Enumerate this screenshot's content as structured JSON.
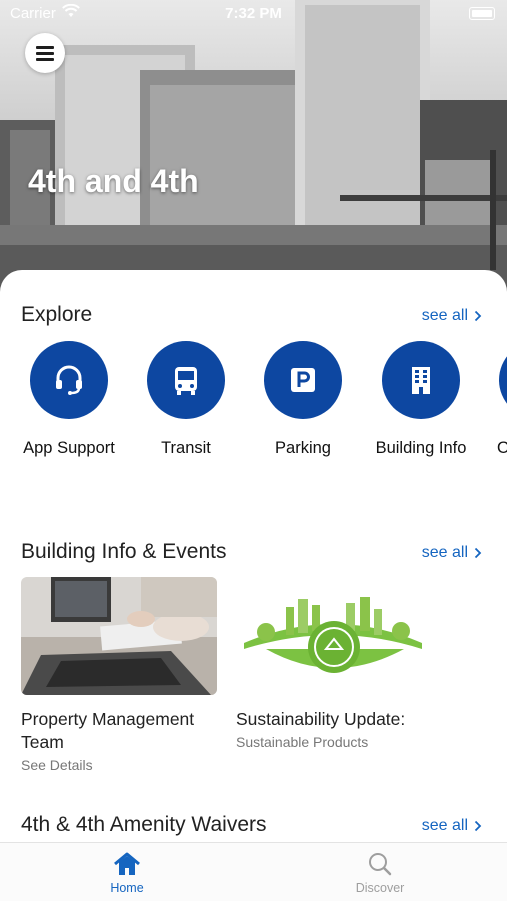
{
  "status_bar": {
    "carrier": "Carrier",
    "time": "7:32 PM"
  },
  "hero": {
    "title": "4th and 4th"
  },
  "explore": {
    "title": "Explore",
    "see_all": "see all",
    "items": [
      {
        "label": "App Support",
        "icon": "headset-icon"
      },
      {
        "label": "Transit",
        "icon": "bus-icon"
      },
      {
        "label": "Parking",
        "icon": "parking-icon"
      },
      {
        "label": "Building Info",
        "icon": "building-icon"
      },
      {
        "label": "O",
        "icon": "partial-icon"
      }
    ]
  },
  "building_info": {
    "title": "Building Info & Events",
    "see_all": "see all",
    "cards": [
      {
        "title": "Property Management Team",
        "subtitle": "See Details",
        "image": "office-laptop-photo"
      },
      {
        "title": "Sustainability Update:",
        "subtitle": "Sustainable Products",
        "image": "green-city-globe-illustration"
      }
    ]
  },
  "amenity": {
    "title": "4th & 4th Amenity Waivers",
    "see_all": "see all"
  },
  "tab_bar": {
    "tabs": [
      {
        "label": "Home",
        "icon": "home-icon",
        "active": true
      },
      {
        "label": "Discover",
        "icon": "search-icon",
        "active": false
      }
    ]
  },
  "colors": {
    "accent": "#0d47a1",
    "link": "#1565c0",
    "eco_green": "#7cc242",
    "inactive": "#9e9e9e"
  }
}
